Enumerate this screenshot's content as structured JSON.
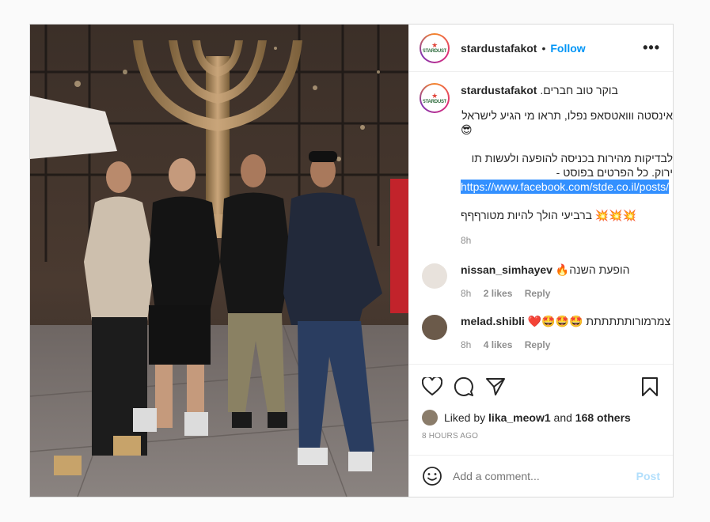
{
  "post": {
    "username": "stardustafakot",
    "follow_label": "Follow",
    "more_label": "•••",
    "photo_alt": "Four men standing in front of a golden menorah sculpture"
  },
  "caption": {
    "username": "stardustafakot",
    "line1": "בוקר טוב חברים.",
    "line2": "אינסטה ווואטסאפ נפלו, תראו מי הגיע לישראל",
    "line3": "😎",
    "line4": "לבדיקות מהירות בכניסה להופעה ולעשות תו",
    "line5": "ירוק. כל הפרטים בפוסט -",
    "link": "https://www.facebook.com/stde.co.il/posts/",
    "line6": "💥💥💥 ברביעי הולך להיות מטורףףף",
    "time": "8h"
  },
  "comments": [
    {
      "username": "nissan_simhayev",
      "text": "הופעת השנה🔥",
      "time": "8h",
      "likes": "2 likes",
      "reply": "Reply"
    },
    {
      "username": "melad.shibli",
      "text": "צמרמורותתתתתת 🤩🤩🤩❤️",
      "time": "8h",
      "likes": "4 likes",
      "reply": "Reply"
    }
  ],
  "likes": {
    "prefix": "Liked by",
    "user": "lika_meow1",
    "and": "and",
    "others": "168 others"
  },
  "date": "8 HOURS AGO",
  "add_comment": {
    "placeholder": "Add a comment...",
    "post_label": "Post"
  },
  "logo": {
    "text": "STARDUST"
  }
}
